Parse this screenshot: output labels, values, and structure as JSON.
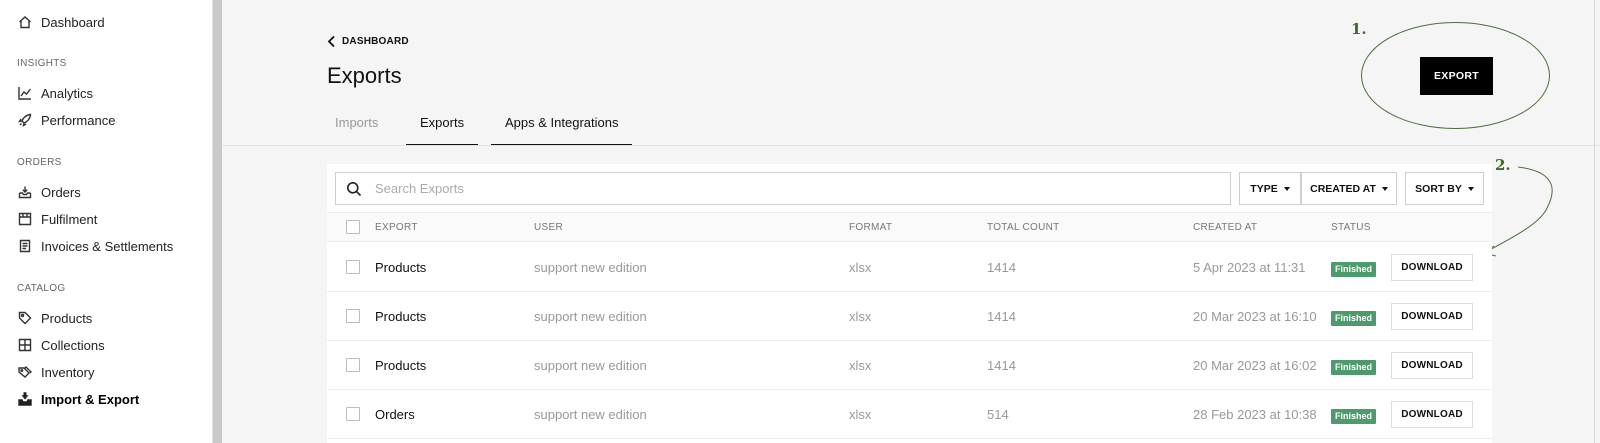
{
  "sidebar": {
    "top": {
      "label": "Dashboard",
      "icon": "home-icon"
    },
    "sections": [
      {
        "heading": "INSIGHTS",
        "items": [
          {
            "label": "Analytics",
            "icon": "chart-line-icon"
          },
          {
            "label": "Performance",
            "icon": "rocket-icon"
          }
        ]
      },
      {
        "heading": "ORDERS",
        "items": [
          {
            "label": "Orders",
            "icon": "inbox-icon"
          },
          {
            "label": "Fulfilment",
            "icon": "package-icon"
          },
          {
            "label": "Invoices & Settlements",
            "icon": "document-icon"
          }
        ]
      },
      {
        "heading": "CATALOG",
        "items": [
          {
            "label": "Products",
            "icon": "tag-icon"
          },
          {
            "label": "Collections",
            "icon": "grid-icon"
          },
          {
            "label": "Inventory",
            "icon": "tags-icon"
          },
          {
            "label": "Import & Export",
            "icon": "import-export-icon",
            "active": true
          }
        ]
      }
    ]
  },
  "header": {
    "back_label": "DASHBOARD",
    "title": "Exports",
    "export_button": "EXPORT",
    "tabs": [
      "Imports",
      "Exports",
      "Apps & Integrations"
    ]
  },
  "annotations": {
    "one": "1.",
    "two": "2."
  },
  "toolbar": {
    "search_placeholder": "Search Exports",
    "filters": [
      "TYPE",
      "CREATED AT",
      "SORT BY"
    ]
  },
  "table": {
    "columns": [
      "EXPORT",
      "USER",
      "FORMAT",
      "TOTAL COUNT",
      "CREATED AT",
      "STATUS"
    ],
    "rows": [
      {
        "export": "Products",
        "user": "support new edition",
        "format": "xlsx",
        "count": "1414",
        "created": "5 Apr 2023 at 11:31",
        "status": "Finished",
        "action": "DOWNLOAD"
      },
      {
        "export": "Products",
        "user": "support new edition",
        "format": "xlsx",
        "count": "1414",
        "created": "20 Mar 2023 at 16:10",
        "status": "Finished",
        "action": "DOWNLOAD"
      },
      {
        "export": "Products",
        "user": "support new edition",
        "format": "xlsx",
        "count": "1414",
        "created": "20 Mar 2023 at 16:02",
        "status": "Finished",
        "action": "DOWNLOAD"
      },
      {
        "export": "Orders",
        "user": "support new edition",
        "format": "xlsx",
        "count": "514",
        "created": "28 Feb 2023 at 10:38",
        "status": "Finished",
        "action": "DOWNLOAD"
      }
    ]
  },
  "colors": {
    "accent_annotation": "#3e6b20",
    "status_finished": "#4d9b6d",
    "primary_button": "#000000"
  }
}
